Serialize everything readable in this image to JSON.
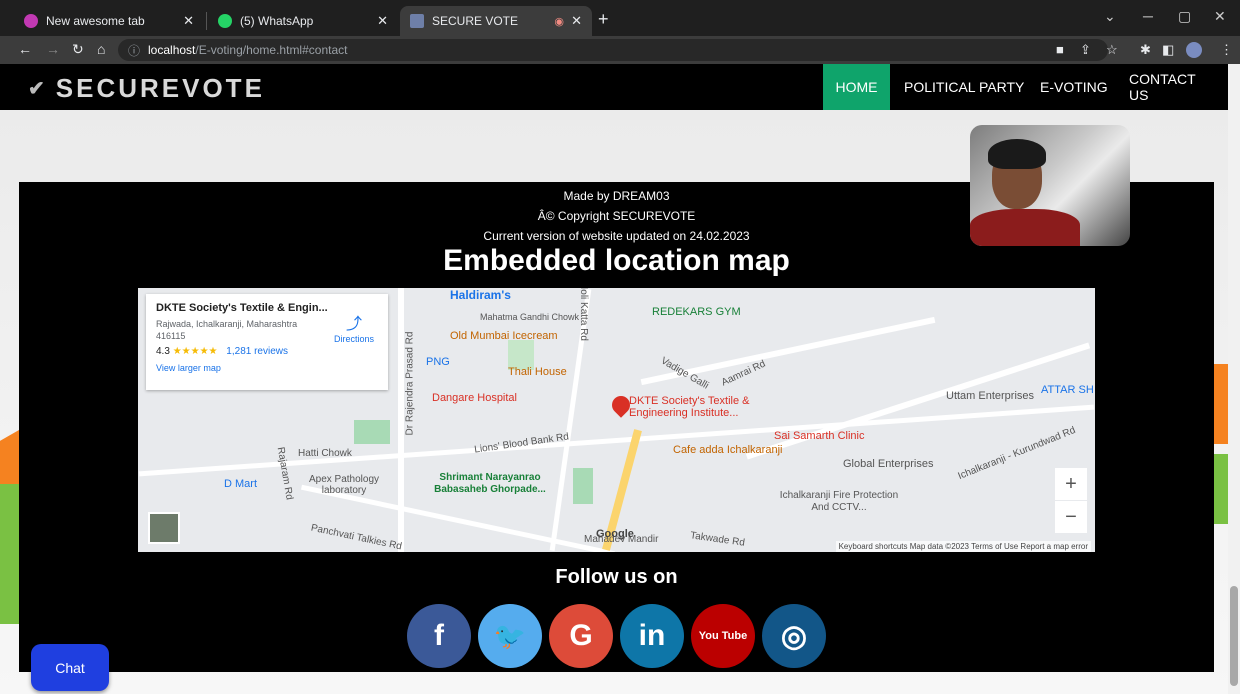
{
  "browser": {
    "tabs": [
      {
        "label": "New awesome tab",
        "active": false,
        "favicon_color": "#c239b3"
      },
      {
        "label": "(5) WhatsApp",
        "active": false,
        "favicon_color": "#25d366"
      },
      {
        "label": "SECURE VOTE",
        "active": true,
        "favicon_color": "#6e7fa8"
      }
    ],
    "url_host": "localhost",
    "url_path": "/E-voting/home.html#contact"
  },
  "site": {
    "logo": "SECUREVOTE",
    "nav": [
      {
        "label": "HOME",
        "active": true
      },
      {
        "label": "POLITICAL PARTY",
        "active": false
      },
      {
        "label": "E-VOTING",
        "active": false
      },
      {
        "label": "CONTACT US",
        "active": false
      }
    ],
    "accent_color": "#0fa46b"
  },
  "footer": {
    "made_by": "Made by DREAM03",
    "copyright": "Â© Copyright SECUREVOTE",
    "version": "Current version of website updated on 24.02.2023",
    "map_title": "Embedded location map",
    "follow_title": "Follow us on"
  },
  "map": {
    "card_name": "DKTE Society's Textile & Engin...",
    "card_address": "Rajwada, Ichalkaranji, Maharashtra 416115",
    "card_rating": "4.3",
    "card_stars": "★★★★★",
    "card_reviews": "1,281 reviews",
    "card_larger": "View larger map",
    "card_directions": "Directions",
    "pois": [
      {
        "label": "Haldiram's",
        "color": "#1a73e8"
      },
      {
        "label": "Old Mumbai Icecream",
        "color": "#c26401"
      },
      {
        "label": "Thali House",
        "color": "#c26401"
      },
      {
        "label": "Dangare Hospital",
        "color": "#d93025"
      },
      {
        "label": "DKTE Society's Textile & Engineering Institute...",
        "color": "#d93025"
      },
      {
        "label": "REDEKARS GYM",
        "color": "#188038"
      },
      {
        "label": "Uttam Enterprises",
        "color": "#555555"
      },
      {
        "label": "Sai Samarth Clinic",
        "color": "#d93025"
      },
      {
        "label": "Cafe adda Ichalkaranji",
        "color": "#c26401"
      },
      {
        "label": "Global Enterprises",
        "color": "#555555"
      },
      {
        "label": "Shrimant Narayanrao Babasaheb Ghorpade...",
        "color": "#188038"
      },
      {
        "label": "Apex Pathology laboratory",
        "color": "#555555"
      },
      {
        "label": "D Mart",
        "color": "#1a73e8"
      },
      {
        "label": "Ichalkaranji Fire Protection And CCTV...",
        "color": "#555555"
      },
      {
        "label": "PNG",
        "color": "#1a73e8"
      },
      {
        "label": "Mahadev Mandir",
        "color": "#555555"
      },
      {
        "label": "ATTAR SH",
        "color": "#1a73e8"
      }
    ],
    "streets": [
      "Lions' Blood Bank Rd",
      "Vadige Galli",
      "Aamrai Rd",
      "Ichalkaranji - Kurundwad Rd",
      "Panchvati Talkies Rd",
      "Takwade Rd",
      "Dr Rajendra Prasad Rd",
      "Rajaram Rd",
      "Holi Katta Rd",
      "Hatti Chowk",
      "Mahatma Gandhi Chowk"
    ],
    "attribution": "Keyboard shortcuts   Map data ©2023   Terms of Use   Report a map error",
    "google": "Google",
    "zoom_in": "+",
    "zoom_out": "−"
  },
  "socials": [
    {
      "name": "facebook",
      "glyph": "f",
      "color": "#3b5998"
    },
    {
      "name": "twitter",
      "glyph": "t",
      "color": "#55acee"
    },
    {
      "name": "google",
      "glyph": "G",
      "color": "#dd4b39"
    },
    {
      "name": "linkedin",
      "glyph": "in",
      "color": "#0e76a8"
    },
    {
      "name": "youtube",
      "glyph": "You Tube",
      "color": "#bb0000"
    },
    {
      "name": "instagram",
      "glyph": "◎",
      "color": "#125688"
    }
  ],
  "chat": {
    "label": "Chat"
  }
}
